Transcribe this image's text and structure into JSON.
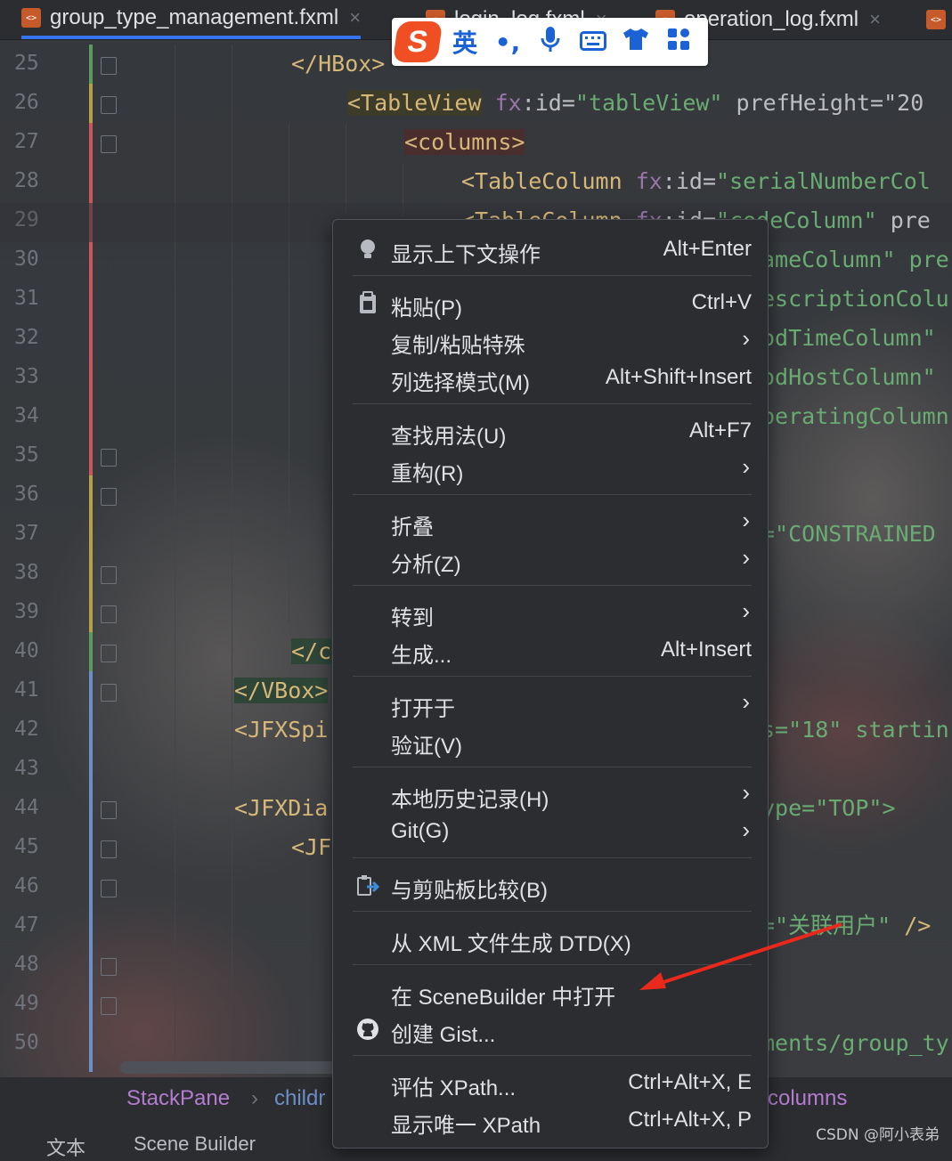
{
  "tabs": [
    {
      "label": "group_type_management.fxml",
      "active": true
    },
    {
      "label": "login_log.fxml",
      "active": false
    },
    {
      "label": "operation_log.fxml",
      "active": false
    }
  ],
  "ime": {
    "lang": "英",
    "punct": "•,",
    "logo": "S"
  },
  "gutter": {
    "lines": [
      "25",
      "26",
      "27",
      "28",
      "29",
      "30",
      "31",
      "32",
      "33",
      "34",
      "35",
      "36",
      "37",
      "38",
      "39",
      "40",
      "41",
      "42",
      "43",
      "44",
      "45",
      "46",
      "47",
      "48",
      "49",
      "50"
    ],
    "current": "29"
  },
  "code": {
    "l25": "</HBox>",
    "l26_tag": "<TableView",
    "l26_ns": "fx",
    "l26_attr": ":id=",
    "l26_val": "\"tableView\"",
    "l26_rest": " prefHeight=\"20",
    "l27": "<columns>",
    "l28_tag": "<TableColumn",
    "l28_ns": "fx",
    "l28_attr": ":id=",
    "l28_val": "\"serialNumberCol",
    "l29_tag": "<TableColumn",
    "l29_ns": "fx",
    "l29_attr": ":id=",
    "l29_val": "\"codeColumn\"",
    "l29_rest": " pre",
    "l30": "ameColumn\" pre",
    "l31": "escriptionColu",
    "l32": "odTimeColumn\"",
    "l33": "odHostColumn\"",
    "l34": "peratingColumn",
    "l37": "=\"CONSTRAINED",
    "l40": "</c",
    "l41": "</VBox>",
    "l42_a": "<JFXSpi",
    "l42_b": "s=\"18\" startin",
    "l44_a": "<JFXDia",
    "l44_b": "ype=\"TOP\">",
    "l45": "<JF",
    "l47_val": "=\"关联用户\"",
    "l47_end": " />",
    "l50": "ments/group_ty"
  },
  "breadcrumbs": {
    "items": [
      "StackPane",
      "childr",
      "columns"
    ],
    "sep": "›"
  },
  "bottom_tabs": [
    "文本",
    "Scene Builder"
  ],
  "menu": {
    "items": [
      {
        "label": "显示上下文操作",
        "shortcut": "Alt+Enter",
        "icon": "lightbulb-icon"
      },
      {
        "label": "粘贴(P)",
        "shortcut": "Ctrl+V",
        "icon": "clipboard-icon"
      },
      {
        "label": "复制/粘贴特殊",
        "submenu": true
      },
      {
        "label": "列选择模式(M)",
        "shortcut": "Alt+Shift+Insert"
      },
      {
        "label": "查找用法(U)",
        "shortcut": "Alt+F7"
      },
      {
        "label": "重构(R)",
        "submenu": true
      },
      {
        "label": "折叠",
        "submenu": true
      },
      {
        "label": "分析(Z)",
        "submenu": true
      },
      {
        "label": "转到",
        "submenu": true
      },
      {
        "label": "生成...",
        "shortcut": "Alt+Insert"
      },
      {
        "label": "打开于",
        "submenu": true
      },
      {
        "label": "验证(V)"
      },
      {
        "label": "本地历史记录(H)",
        "submenu": true
      },
      {
        "label": "Git(G)",
        "submenu": true
      },
      {
        "label": "与剪贴板比较(B)",
        "icon": "compare-icon"
      },
      {
        "label": "从 XML 文件生成 DTD(X)"
      },
      {
        "label": "在 SceneBuilder 中打开"
      },
      {
        "label": "创建 Gist...",
        "icon": "github-icon"
      },
      {
        "label": "评估 XPath...",
        "shortcut": "Ctrl+Alt+X, E"
      },
      {
        "label": "显示唯一 XPath",
        "shortcut": "Ctrl+Alt+X, P"
      }
    ],
    "chevron": "›"
  },
  "watermark": "CSDN @阿小表弟",
  "colors": {
    "accent": "#3574f0",
    "annotation_arrow": "#e8291c",
    "tag": "#d5b778",
    "string": "#6aab73"
  }
}
